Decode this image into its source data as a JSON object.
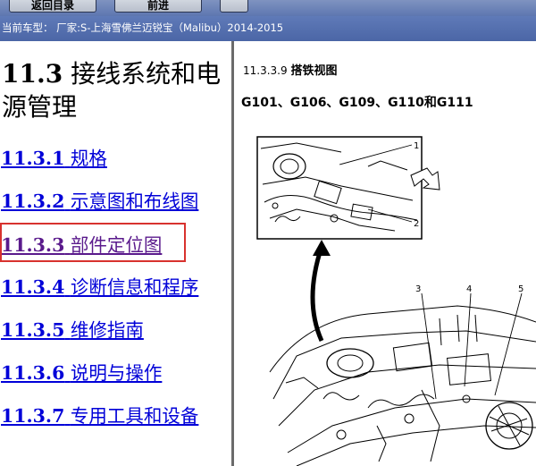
{
  "toolbar": {
    "buttons": [
      "返回目录",
      "前进",
      ""
    ]
  },
  "vehicle_bar": {
    "text": "当前车型： 厂家:S-上海雪佛兰迈锐宝（Malibu）2014-2015"
  },
  "nav": {
    "section_number": "11.3",
    "section_title": "接线系统和电源管理",
    "items": [
      {
        "num": "11.3.1",
        "label": "规格"
      },
      {
        "num": "11.3.2",
        "label": "示意图和布线图"
      },
      {
        "num": "11.3.3",
        "label": "部件定位图"
      },
      {
        "num": "11.3.4",
        "label": "诊断信息和程序"
      },
      {
        "num": "11.3.5",
        "label": "维修指南"
      },
      {
        "num": "11.3.6",
        "label": "说明与操作"
      },
      {
        "num": "11.3.7",
        "label": "专用工具和设备"
      }
    ],
    "highlighted_index": 2
  },
  "content": {
    "sub_id": "11.3.3.9",
    "sub_title": "搭铁视图",
    "ground_heading": "G101、G106、G109、G110和G111",
    "callouts": [
      "1",
      "2",
      "3",
      "4",
      "5"
    ]
  },
  "colors": {
    "link": "#0000d8",
    "visited_link": "#5a1a8c",
    "highlight_border": "#d8322e",
    "header_blue": "#5f7ab8"
  }
}
